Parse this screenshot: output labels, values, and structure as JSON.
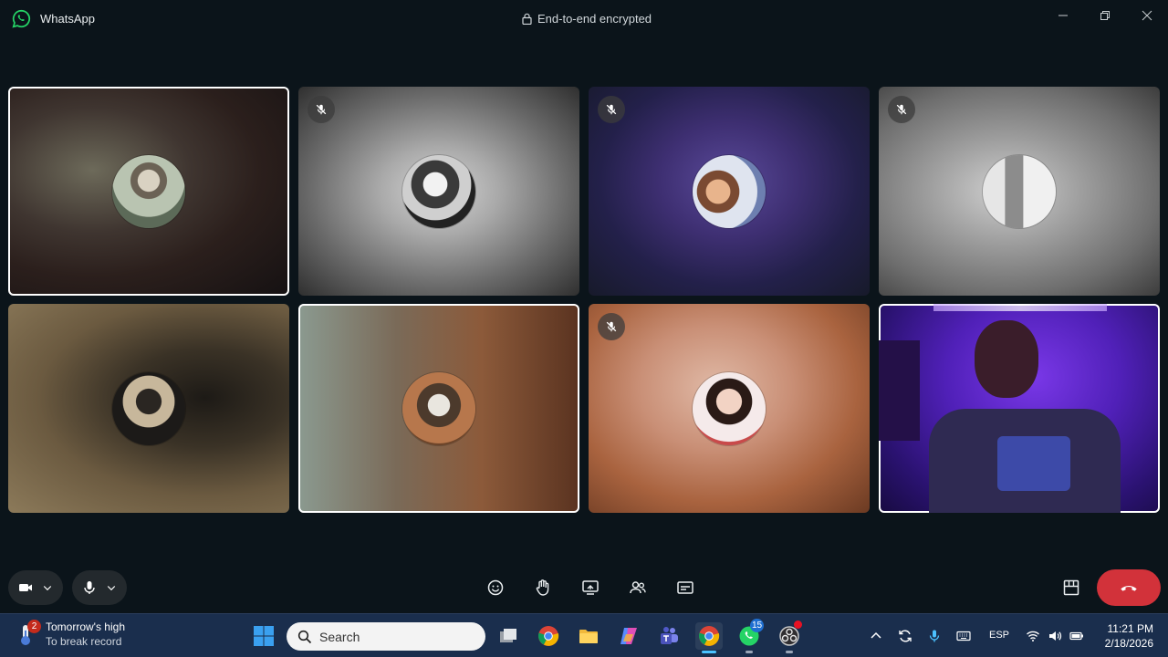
{
  "window": {
    "app_name": "WhatsApp",
    "encryption_label": "End-to-end encrypted"
  },
  "participants": [
    {
      "muted": false,
      "active": true
    },
    {
      "muted": true,
      "active": false
    },
    {
      "muted": true,
      "active": false
    },
    {
      "muted": true,
      "active": false
    },
    {
      "muted": false,
      "active": false
    },
    {
      "muted": false,
      "active": true
    },
    {
      "muted": true,
      "active": false
    },
    {
      "muted": false,
      "active": true,
      "video_on": true
    }
  ],
  "controls": {
    "camera": "camera-icon",
    "microphone": "microphone-icon",
    "reactions": "emoji-icon",
    "raise_hand": "raise-hand-icon",
    "share_screen": "share-screen-icon",
    "participants": "participants-icon",
    "captions": "captions-icon",
    "layout": "layout-icon",
    "end_call": "end-call-icon",
    "end_call_color": "#d2323a"
  },
  "taskbar": {
    "weather": {
      "badge": "2",
      "line1": "Tomorrow's high",
      "line2": "To break record"
    },
    "search_placeholder": "Search",
    "whatsapp_badge": "15",
    "language": "ESP",
    "time": "11:21 PM",
    "date": "2/18/2026"
  },
  "colors": {
    "background": "#0b141a",
    "accent": "#25d366",
    "taskbar": "#1a2e4d"
  }
}
